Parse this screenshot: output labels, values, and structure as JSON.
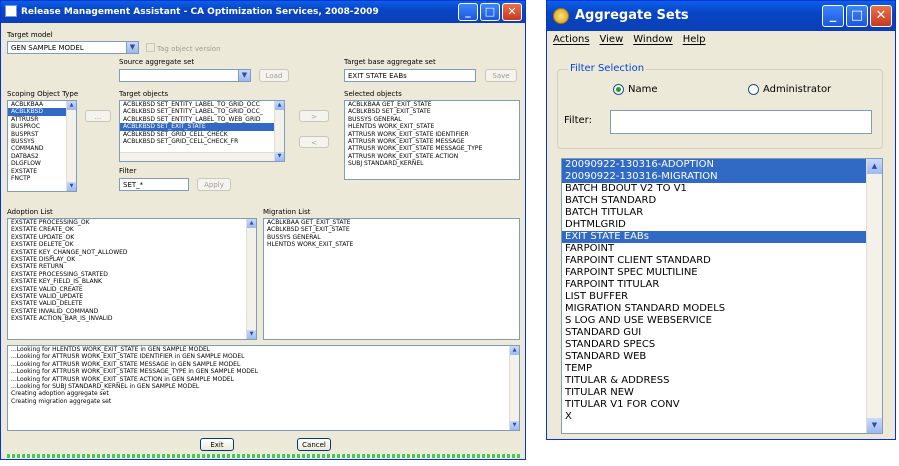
{
  "left_window": {
    "title": "Release Management Assistant - CA Optimization Services, 2008-2009",
    "target_model_label": "Target model",
    "target_model_value": "GEN SAMPLE MODEL",
    "tag_object_version": "Tag object version",
    "source_aggregate_label": "Source aggregate set",
    "source_aggregate_value": "",
    "load_button": "Load",
    "target_base_label": "Target base aggregate set",
    "target_base_value": "EXIT STATE EABs",
    "save_button": "Save",
    "scoping_label": "Scoping Object Type",
    "scoping_items": [
      "ACBLKBAA",
      "ACBLKBSD",
      "ATTRUSR",
      "BUSPROC",
      "BUSPRST",
      "BUSSYS",
      "COMMAND",
      "DATBAS2",
      "DLGFLOW",
      "EXSTATE",
      "FNCTP"
    ],
    "scoping_selected": 1,
    "target_objects_label": "Target objects",
    "target_objects": [
      "ACBLKBSD SET_ENTITY_LABEL_TO_GRID_OCC",
      "ACBLKBSD SET_ENTITY_LABEL_TO_GRID_OCC_",
      "ACBLKBSD SET_ENTITY_LABEL_TO_WEB_GRID",
      "ACBLKBSD SET_EXIT_STATE",
      "ACBLKBSD SET_GRID_CELL_CHECK",
      "ACBLKBSD SET_GRID_CELL_CHECK_FR"
    ],
    "target_selected": 3,
    "move_right": ">",
    "move_left": "<",
    "selected_objects_label": "Selected objects",
    "selected_objects": [
      "ACBLKBAA GET_EXIT_STATE",
      "ACBLKBSD SET_EXIT_STATE",
      "BUSSYS GENERAL",
      "HLENTDS WORK_EXIT_STATE",
      "ATTRUSR WORK_EXIT_STATE IDENTIFIER",
      "ATTRUSR WORK_EXIT_STATE MESSAGE",
      "ATTRUSR WORK_EXIT_STATE MESSAGE_TYPE",
      "ATTRUSR WORK_EXIT_STATE ACTION",
      "SUBJ STANDARD_KERNEL"
    ],
    "filter_label": "Filter",
    "filter_value": "SET_*",
    "apply_button": "Apply",
    "adoption_label": "Adoption List",
    "adoption_items": [
      "EXSTATE PROCESSING_OK",
      "EXSTATE CREATE_OK",
      "EXSTATE UPDATE_OK",
      "EXSTATE DELETE_OK",
      "EXSTATE KEY_CHANGE_NOT_ALLOWED",
      "EXSTATE DISPLAY_OK",
      "EXSTATE RETURN",
      "EXSTATE PROCESSING_STARTED",
      "EXSTATE KEY_FIELD_IS_BLANK",
      "EXSTATE VALID_CREATE",
      "EXSTATE VALID_UPDATE",
      "EXSTATE VALID_DELETE",
      "EXSTATE INVALID_COMMAND",
      "EXSTATE ACTION_BAR_IS_INVALID"
    ],
    "migration_label": "Migration List",
    "migration_items": [
      "ACBLKBAA GET_EXIT_STATE",
      "ACBLKBSD SET_EXIT_STATE",
      "BUSSYS GENERAL",
      "HLENTDS WORK_EXIT_STATE"
    ],
    "log_lines": [
      "...Looking for HLENTDS WORK_EXIT_STATE in GEN SAMPLE MODEL",
      "...Looking for ATTRUSR WORK_EXIT_STATE IDENTIFIER in GEN SAMPLE MODEL",
      "...Looking for ATTRUSR WORK_EXIT_STATE MESSAGE in GEN SAMPLE MODEL",
      "...Looking for ATTRUSR WORK_EXIT_STATE MESSAGE_TYPE in GEN SAMPLE MODEL",
      "...Looking for ATTRUSR WORK_EXIT_STATE ACTION in GEN SAMPLE MODEL",
      "...Looking for SUBJ STANDARD_KERNEL in GEN SAMPLE MODEL",
      "Creating adoption aggregate set",
      "Creating migration aggregate set"
    ],
    "exit_button": "Exit",
    "cancel_button": "Cancel",
    "progress": 1.0
  },
  "right_window": {
    "title": "Aggregate Sets",
    "menu": [
      "Actions",
      "View",
      "Window",
      "Help"
    ],
    "filter_group": "Filter Selection",
    "radio_name": "Name",
    "radio_admin": "Administrator",
    "radio_selected": "Name",
    "filter_label": "Filter:",
    "filter_value": "",
    "items": [
      "20090922-130316-ADOPTION",
      "20090922-130316-MIGRATION",
      "BATCH BDOUT V2 TO V1",
      "BATCH STANDARD",
      "BATCH TITULAR",
      "DHTMLGRID",
      "EXIT STATE EABs",
      "FARPOINT",
      "FARPOINT CLIENT STANDARD",
      "FARPOINT SPEC MULTILINE",
      "FARPOINT TITULAR",
      "LIST BUFFER",
      "MIGRATION STANDARD MODELS",
      "S LOG AND USE WEBSERVICE",
      "STANDARD GUI",
      "STANDARD SPECS",
      "STANDARD WEB",
      "TEMP",
      "TITULAR & ADDRESS",
      "TITULAR NEW",
      "TITULAR V1 FOR CONV",
      "X"
    ],
    "selected_items": [
      0,
      1,
      6
    ]
  },
  "colors": {
    "titlebar": "#0a4fd6",
    "selection": "#316ac5",
    "window_bg": "#ece9d8",
    "progress": "#3ad43a"
  }
}
